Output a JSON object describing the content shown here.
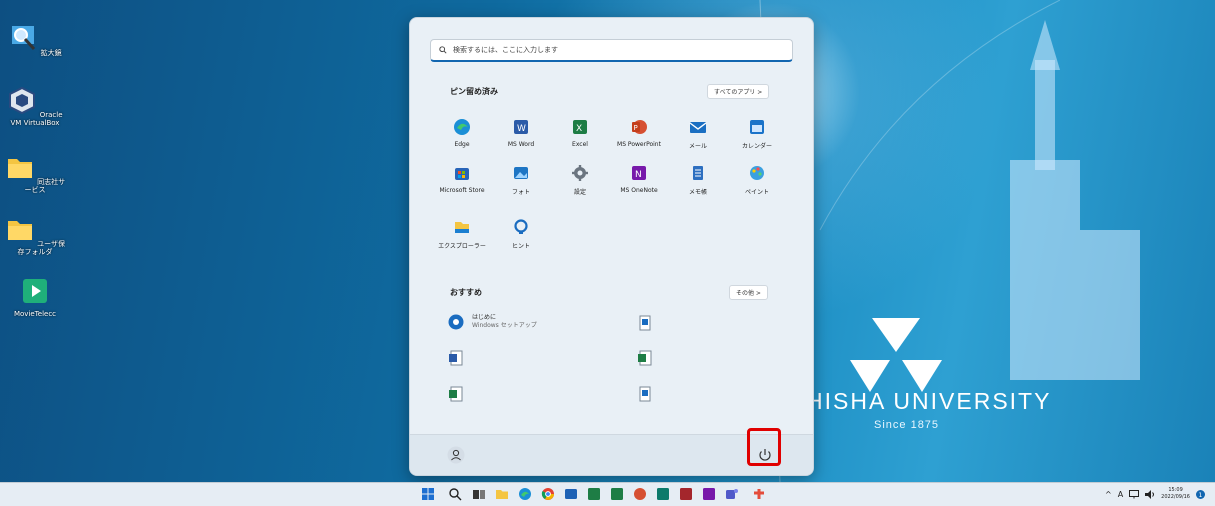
{
  "desktop": {
    "icons": [
      {
        "label": "拡大鏡",
        "icon": "magnifier-icon"
      },
      {
        "label": "Oracle VM VirtualBox",
        "icon": "virtualbox-icon"
      },
      {
        "label": "同志社サービス",
        "icon": "folder-icon"
      },
      {
        "label": "ユーザ保存フォルダ",
        "icon": "folder-icon"
      },
      {
        "label": "MovieTelecc",
        "icon": "movie-icon"
      }
    ],
    "wallpaper_text": "HISHA UNIVERSITY",
    "wallpaper_sub": "Since 1875"
  },
  "start_menu": {
    "search_placeholder": "検索するには、ここに入力します",
    "pinned_title": "ピン留め済み",
    "all_apps_label": "すべてのアプリ  >",
    "pinned": [
      {
        "label": "Edge",
        "icon": "edge-icon"
      },
      {
        "label": "MS Word",
        "icon": "word-icon"
      },
      {
        "label": "Excel",
        "icon": "excel-icon"
      },
      {
        "label": "MS PowerPoint",
        "icon": "powerpoint-icon"
      },
      {
        "label": "メール",
        "icon": "mail-icon"
      },
      {
        "label": "カレンダー",
        "icon": "calendar-icon"
      },
      {
        "label": "Microsoft Store",
        "icon": "store-icon"
      },
      {
        "label": "フォト",
        "icon": "photos-icon"
      },
      {
        "label": "設定",
        "icon": "settings-icon"
      },
      {
        "label": "MS OneNote",
        "icon": "onenote-icon"
      },
      {
        "label": "メモ帳",
        "icon": "notepad-icon"
      },
      {
        "label": "ペイント",
        "icon": "paint-icon"
      },
      {
        "label": "エクスプローラー",
        "icon": "explorer-icon"
      },
      {
        "label": "ヒント",
        "icon": "tips-icon"
      }
    ],
    "recommended_title": "おすすめ",
    "more_label": "その他  >",
    "recommended": [
      {
        "title": "はじめに",
        "subtitle": "Windows セットアップ",
        "icon": "getstarted-icon"
      },
      {
        "title": "",
        "subtitle": "",
        "icon": "file-icon"
      },
      {
        "title": "",
        "subtitle": "",
        "icon": "word-doc-icon"
      },
      {
        "title": "",
        "subtitle": "",
        "icon": "excel-doc-icon"
      },
      {
        "title": "",
        "subtitle": "",
        "icon": "excel-doc-icon"
      },
      {
        "title": "",
        "subtitle": "",
        "icon": "file-icon"
      }
    ]
  },
  "taskbar": {
    "icons": [
      "start-icon",
      "search-icon",
      "taskview-icon",
      "explorer-icon",
      "edge-icon",
      "chrome-icon",
      "app-icon",
      "excel-icon",
      "powerpoint-icon",
      "app-icon",
      "access-icon",
      "onenote-icon",
      "teams-icon",
      "app-icon"
    ],
    "tray": {
      "chevron": "^",
      "ime": "A",
      "time": "15:09",
      "date": "2022/09/16"
    }
  },
  "colors": {
    "accent": "#1266b0",
    "highlight": "#e00000"
  }
}
